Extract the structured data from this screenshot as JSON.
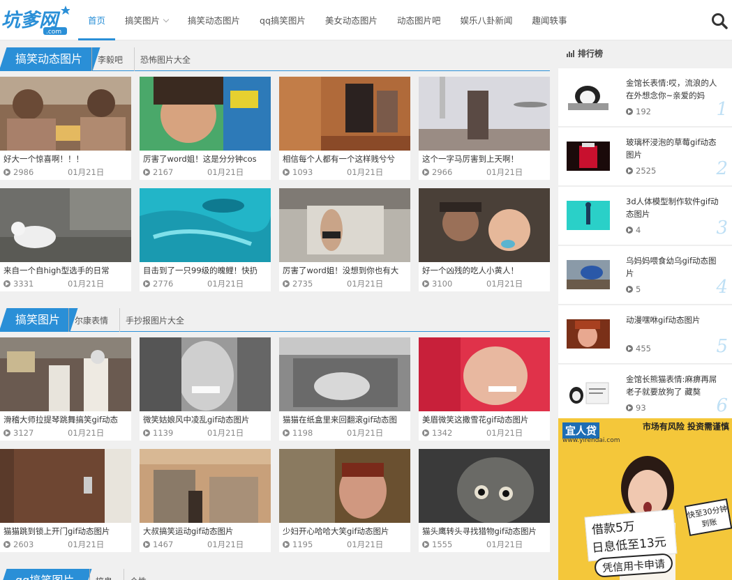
{
  "header": {
    "logo_text": "坑爹网",
    "logo_sub": ".com",
    "nav": [
      {
        "label": "首页",
        "active": true
      },
      {
        "label": "搞笑图片",
        "active": false,
        "has_dropdown": true
      },
      {
        "label": "搞笑动态图片",
        "active": false
      },
      {
        "label": "qq搞笑图片",
        "active": false
      },
      {
        "label": "美女动态图片",
        "active": false
      },
      {
        "label": "动态图片吧",
        "active": false
      },
      {
        "label": "娱乐八卦新闻",
        "active": false
      },
      {
        "label": "趣闻轶事",
        "active": false
      }
    ],
    "search_icon": "search-icon"
  },
  "sections": [
    {
      "title": "搞笑动态图片",
      "links": [
        "李毅吧",
        "恐怖图片大全"
      ],
      "cards": [
        {
          "title": "好大一个惊喜啊！！！",
          "views": "2986",
          "date": "01月21日"
        },
        {
          "title": "厉害了word姐！这是分分钟cos",
          "views": "2167",
          "date": "01月21日"
        },
        {
          "title": "相信每个人都有一个这样贱兮兮",
          "views": "1093",
          "date": "01月21日"
        },
        {
          "title": "这个一字马厉害到上天啊！",
          "views": "2966",
          "date": "01月21日"
        },
        {
          "title": "来自一个自high型选手的日常",
          "views": "3331",
          "date": "01月21日"
        },
        {
          "title": "目击到了一只99级的魄鲤！快扔",
          "views": "2776",
          "date": "01月21日"
        },
        {
          "title": "厉害了word姐！没想到你也有大",
          "views": "2735",
          "date": "01月21日"
        },
        {
          "title": "好一个凶残的吃人小黄人！",
          "views": "3100",
          "date": "01月21日"
        }
      ]
    },
    {
      "title": "搞笑图片",
      "links": [
        "尔康表情",
        "手抄报图片大全"
      ],
      "cards": [
        {
          "title": "滑稽大师拉提琴跳舞搞笑gif动态",
          "views": "3127",
          "date": "01月21日"
        },
        {
          "title": "微笑姑娘风中凌乱gif动态图片",
          "views": "1139",
          "date": "01月21日"
        },
        {
          "title": "猫猫在纸盒里来回翻滚gif动态图",
          "views": "1198",
          "date": "01月21日"
        },
        {
          "title": "美眉微笑这撒雪花gif动态图片",
          "views": "1342",
          "date": "01月21日"
        },
        {
          "title": "猫猫跳到锁上开门gif动态图片",
          "views": "2603",
          "date": "01月21日"
        },
        {
          "title": "大叔搞笑运动gif动态图片",
          "views": "1467",
          "date": "01月21日"
        },
        {
          "title": "少妇开心哈哈大笑gif动态图片",
          "views": "1195",
          "date": "01月21日"
        },
        {
          "title": "猫头鹰转头寻找猎物gif动态图片",
          "views": "1555",
          "date": "01月21日"
        }
      ]
    },
    {
      "title": "qq搞笑图片",
      "links": [
        "搞鬼",
        "个性"
      ]
    }
  ],
  "sidebar": {
    "title": "排行榜",
    "items": [
      {
        "title": "金馆长表情:哎，流浪的人在外想念你~亲爱的妈",
        "views": "192",
        "rank": "1"
      },
      {
        "title": "玻璃杯浸泡的草莓gif动态图片",
        "views": "2525",
        "rank": "2"
      },
      {
        "title": "3d人体模型制作软件gif动态图片",
        "views": "4",
        "rank": "3"
      },
      {
        "title": "乌妈妈喂食幼乌gif动态图片",
        "views": "5",
        "rank": "4"
      },
      {
        "title": "动漫嘿咻gif动态图片",
        "views": "455",
        "rank": "5"
      },
      {
        "title": "金馆长熊猫表情:麻痹再屌老子就要放狗了 藏獒",
        "views": "93",
        "rank": "6"
      }
    ]
  },
  "ad": {
    "brand": "宜人贷",
    "url": "www.yirendai.com",
    "risk": "市场有风险 投资需谨慎",
    "line1": "借款5万",
    "line2": "日息低至13元",
    "tag": "快至30分钟到账",
    "button": "凭信用卡申请"
  },
  "colors": {
    "accent": "#2a8fd7",
    "ad_bg": "#f4c73a"
  }
}
